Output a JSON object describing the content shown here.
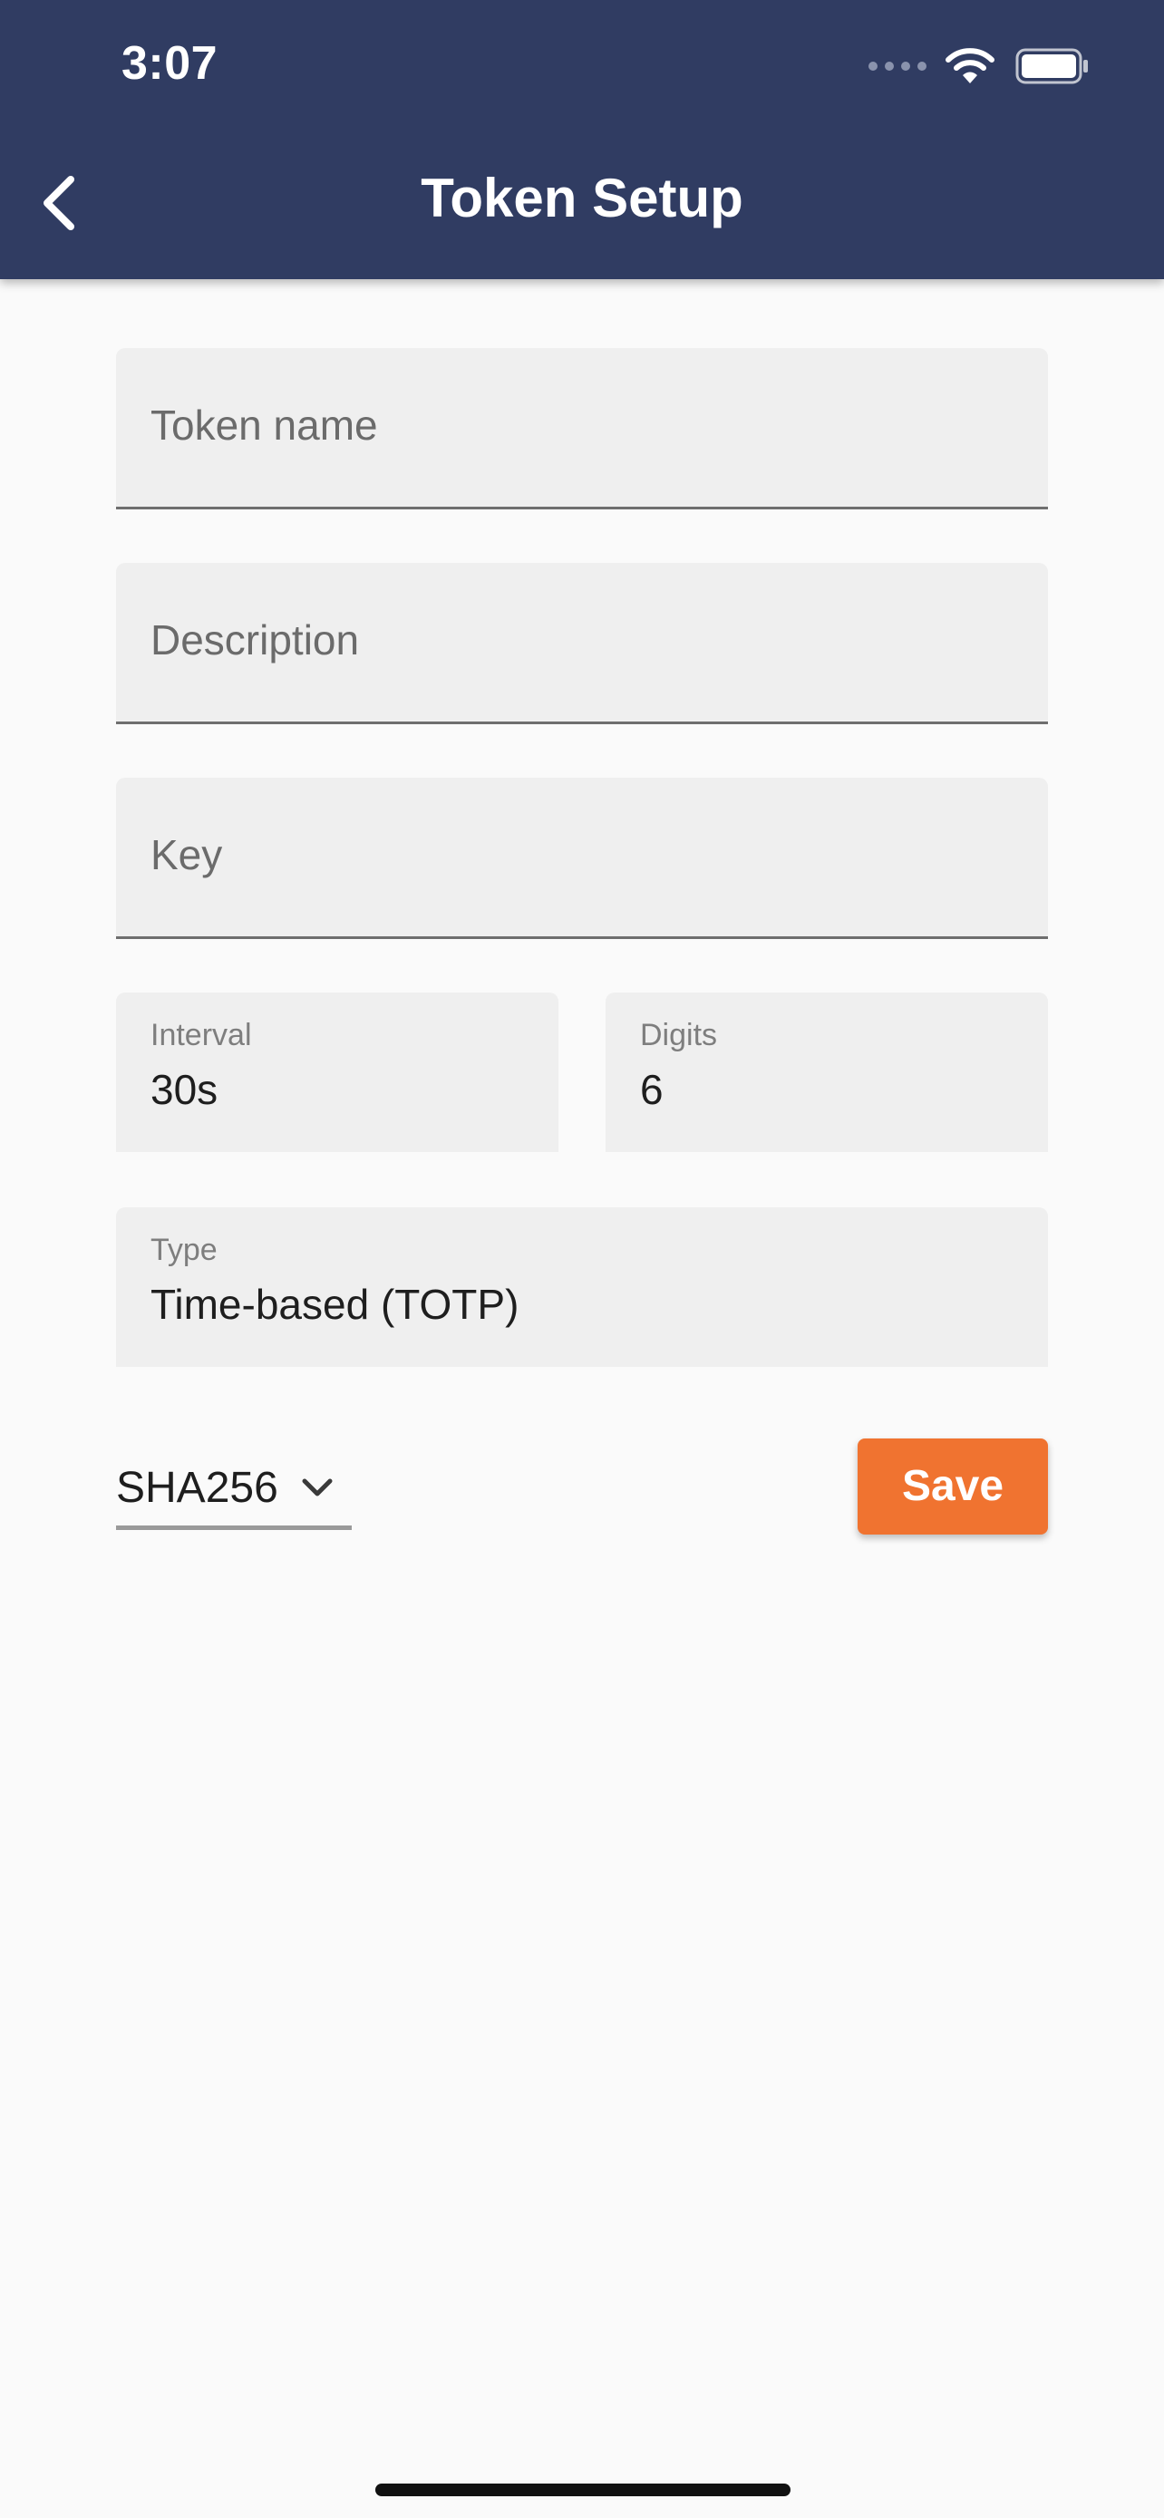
{
  "status_bar": {
    "time": "3:07"
  },
  "app_bar": {
    "title": "Token Setup",
    "back_icon": "chevron-left-icon",
    "background": "#303c62"
  },
  "form": {
    "token_name": {
      "placeholder": "Token name",
      "value": ""
    },
    "description": {
      "placeholder": "Description",
      "value": ""
    },
    "key": {
      "placeholder": "Key",
      "value": ""
    },
    "interval": {
      "label": "Interval",
      "value": "30s"
    },
    "digits": {
      "label": "Digits",
      "value": "6"
    },
    "type": {
      "label": "Type",
      "value": "Time-based (TOTP)"
    }
  },
  "algorithm_dropdown": {
    "selected": "SHA256",
    "icon": "chevron-down-icon"
  },
  "save_button": {
    "label": "Save",
    "color": "#f07330"
  }
}
